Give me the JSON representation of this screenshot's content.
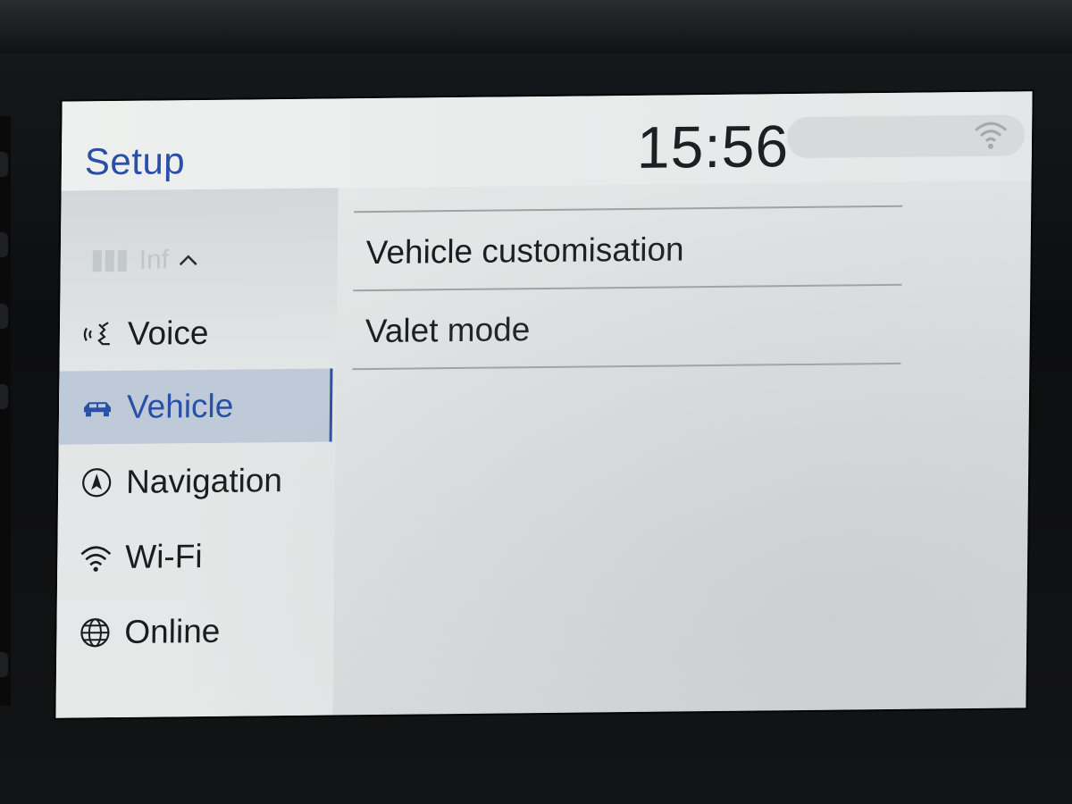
{
  "header": {
    "title": "Setup",
    "clock": "15:56"
  },
  "sidebar": {
    "items": [
      {
        "label": "Inf",
        "icon": "info-icon",
        "state": "faded"
      },
      {
        "label": "Voice",
        "icon": "voice-icon",
        "state": "normal"
      },
      {
        "label": "Vehicle",
        "icon": "car-icon",
        "state": "active"
      },
      {
        "label": "Navigation",
        "icon": "compass-icon",
        "state": "normal"
      },
      {
        "label": "Wi-Fi",
        "icon": "wifi-icon",
        "state": "normal"
      },
      {
        "label": "Online",
        "icon": "globe-icon",
        "state": "normal"
      }
    ]
  },
  "main": {
    "items": [
      {
        "label": "Vehicle customisation"
      },
      {
        "label": "Valet mode"
      }
    ]
  },
  "colors": {
    "accent": "#2a4fa6",
    "active_bg": "#bfcad9",
    "text": "#1b1c1e"
  }
}
